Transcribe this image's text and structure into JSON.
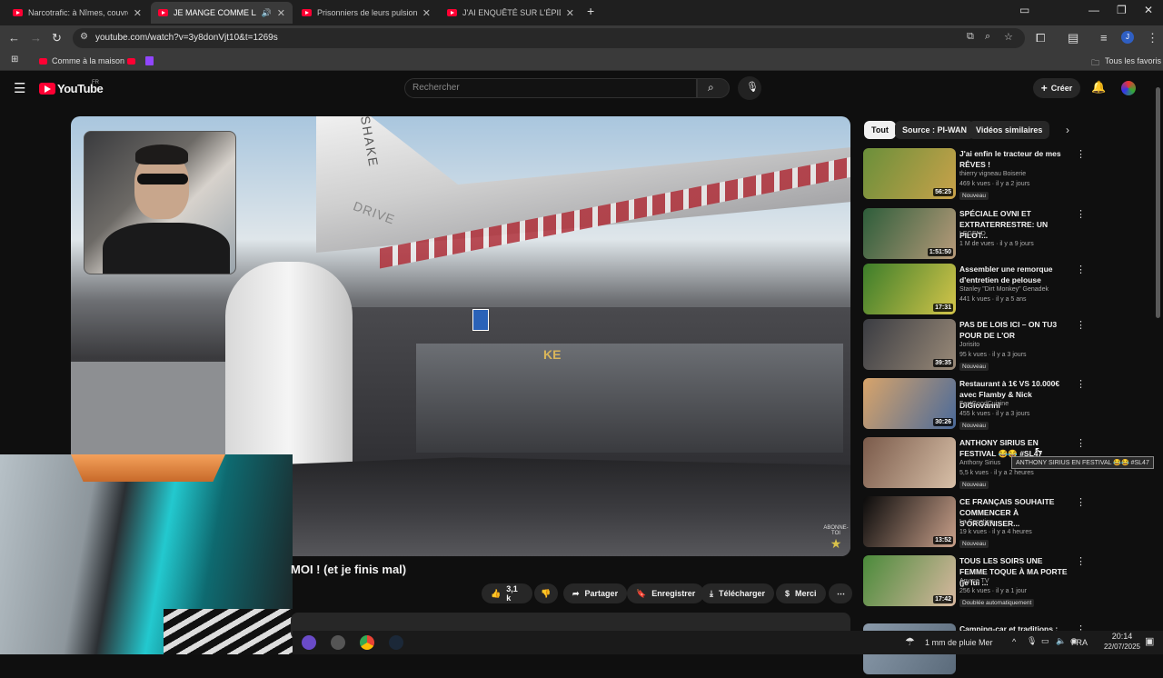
{
  "browser": {
    "tabs": [
      {
        "title": "Narcotrafic: à Nîmes, couvre-fe"
      },
      {
        "title": "JE MANGE COMME LA PERS"
      },
      {
        "title": "Prisonniers de leurs pulsions - Y"
      },
      {
        "title": "J'AI ENQUÊTÉ SUR L'ÉPIDÉMIE"
      }
    ],
    "new_tab": "+",
    "url": "youtube.com/watch?v=3y8donVjt10&t=1269s",
    "bookmarks": {
      "folder": "Comme à la maison",
      "all": "Tous les favoris"
    },
    "profile_initial": "J"
  },
  "youtube": {
    "logo": "YouTube",
    "region": "FR",
    "search_placeholder": "Rechercher",
    "create_label": "Créer"
  },
  "video": {
    "title_visible": "MOI ! (et je finis mal)",
    "likes": "3,1 k",
    "share": "Partager",
    "save": "Enregistrer",
    "download": "Télécharger",
    "thanks": "Merci",
    "scene_text": {
      "top": "SHAKE",
      "drive": "DRIVE",
      "sign": "KE"
    },
    "abonne": "ABONNE-TOI"
  },
  "chips": [
    "Tout",
    "Source : PI-WAN",
    "Vidéos similaires"
  ],
  "recommendations": [
    {
      "title": "J'ai enfin le tracteur de mes RÊVES !",
      "channel": "thierry vigneau Boiserie",
      "meta": "469 k vues · il y a 2 jours",
      "badge": "Nouveau",
      "duration": "56:25",
      "color1": "#6a8f3a",
      "color2": "#c9a24a"
    },
    {
      "title": "SPÉCIALE OVNI ET EXTRATERRESTRE: UN PILOT...",
      "channel": "LEGEND",
      "meta": "1 M de vues · il y a 9 jours",
      "badge": "",
      "duration": "1:51:50",
      "color1": "#2d5d3a",
      "color2": "#b89b7a"
    },
    {
      "title": "Assembler une remorque d'entretien de pelouse",
      "channel": "Stanley \"Dirt Monkey\" Genadek",
      "meta": "441 k vues · il y a 5 ans",
      "badge": "",
      "duration": "17:31",
      "color1": "#3c7d2a",
      "color2": "#d4c54a"
    },
    {
      "title": "PAS DE LOIS ICI – ON TU3 POUR DE L'OR",
      "channel": "Jorisito",
      "meta": "95 k vues · il y a 3 jours",
      "badge": "Nouveau",
      "duration": "39:35",
      "color1": "#3a3c42",
      "color2": "#9a8a78"
    },
    {
      "title": "Restaurant à 1€ VS 10.000€ avec Flamby & Nick DiGiovanni",
      "channel": "FastGoodCuisine",
      "meta": "455 k vues · il y a 3 jours",
      "badge": "Nouveau",
      "duration": "30:26",
      "color1": "#d8a46a",
      "color2": "#4a6a9a"
    },
    {
      "title": "ANTHONY SIRIUS EN FESTIVAL 😂😂 #SL47",
      "channel": "Anthony Sirius",
      "meta": "5,5 k vues · il y a 2 heures",
      "badge": "Nouveau",
      "duration": "",
      "color1": "#7a5a4a",
      "color2": "#d8c0a8"
    },
    {
      "title": "CE FRANÇAIS SOUHAITE COMMENCER À S'ORGANISER...",
      "channel": "La Sanction",
      "meta": "19 k vues · il y a 4 heures",
      "badge": "Nouveau",
      "duration": "13:52",
      "color1": "#0a0a0a",
      "color2": "#c9a08a"
    },
    {
      "title": "TOUS LES SOIRS UNE FEMME TOQUE À MA PORTE (je lui ...",
      "channel": "Anyme TV",
      "meta": "256 k vues · il y a 1 jour",
      "badge": "Doublée automatiquement",
      "duration": "17:42",
      "color1": "#4a8a3a",
      "color2": "#d8b8a0"
    },
    {
      "title": "Camping-car et traditions :",
      "channel": "",
      "meta": "",
      "badge": "",
      "duration": "",
      "color1": "#8a9aaa",
      "color2": "#5a6a7a"
    }
  ],
  "tooltip": "ANTHONY SIRIUS EN FESTIVAL 😂😂 #SL47",
  "taskbar": {
    "weather": "1 mm de pluie Mer",
    "lang": "FRA",
    "time": "20:14",
    "date": "22/07/2025"
  }
}
